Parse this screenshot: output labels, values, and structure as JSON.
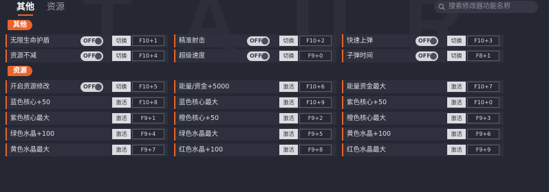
{
  "watermark": "TAUR",
  "tabs": [
    {
      "label": "其他",
      "active": true
    },
    {
      "label": "资源",
      "active": false
    }
  ],
  "search": {
    "placeholder": "搜索修改器功能名称",
    "icon": "search-icon"
  },
  "colors": {
    "accent": "#e9632b",
    "background": "#252733",
    "row": "#2e313d"
  },
  "sections": [
    {
      "label": "其他",
      "rows": [
        [
          {
            "label": "无限生命护盾",
            "toggle": "OFF",
            "action": "切换",
            "hotkey": "F10+1"
          },
          {
            "label": "精准射击",
            "toggle": "OFF",
            "action": "切换",
            "hotkey": "F10+2"
          },
          {
            "label": "快速上弹",
            "toggle": "OFF",
            "action": "切换",
            "hotkey": "F10+3"
          }
        ],
        [
          {
            "label": "资源不减",
            "toggle": "OFF",
            "action": "切换",
            "hotkey": "F10+4"
          },
          {
            "label": "超级速度",
            "toggle": "OFF",
            "action": "切换",
            "hotkey": "F9+0"
          },
          {
            "label": "子弹时间",
            "toggle": "OFF",
            "action": "切换",
            "hotkey": "F8+1"
          }
        ]
      ]
    },
    {
      "label": "资源",
      "rows": [
        [
          {
            "label": "开启资源修改",
            "toggle": "OFF",
            "action": "切换",
            "hotkey": "F10+5"
          },
          {
            "label": "能量/资金+5000",
            "action": "激活",
            "hotkey": "F10+6"
          },
          {
            "label": "能量资金最大",
            "action": "激活",
            "hotkey": "F10+7"
          }
        ],
        [
          {
            "label": "蓝色核心+50",
            "action": "激活",
            "hotkey": "F10+8"
          },
          {
            "label": "蓝色核心最大",
            "action": "激活",
            "hotkey": "F10+9"
          },
          {
            "label": "紫色核心+50",
            "action": "激活",
            "hotkey": "F10+0"
          }
        ],
        [
          {
            "label": "紫色核心最大",
            "action": "激活",
            "hotkey": "F9+1"
          },
          {
            "label": "橙色核心+50",
            "action": "激活",
            "hotkey": "F9+2"
          },
          {
            "label": "橙色核心最大",
            "action": "激活",
            "hotkey": "F9+3"
          }
        ],
        [
          {
            "label": "绿色水晶+100",
            "action": "激活",
            "hotkey": "F9+4"
          },
          {
            "label": "绿色水晶最大",
            "action": "激活",
            "hotkey": "F9+5"
          },
          {
            "label": "黄色水晶+100",
            "action": "激活",
            "hotkey": "F9+6"
          }
        ],
        [
          {
            "label": "黄色水晶最大",
            "action": "激活",
            "hotkey": "F9+7"
          },
          {
            "label": "红色水晶+100",
            "action": "激活",
            "hotkey": "F9+8"
          },
          {
            "label": "红色水晶最大",
            "action": "激活",
            "hotkey": "F9+9"
          }
        ]
      ]
    }
  ]
}
